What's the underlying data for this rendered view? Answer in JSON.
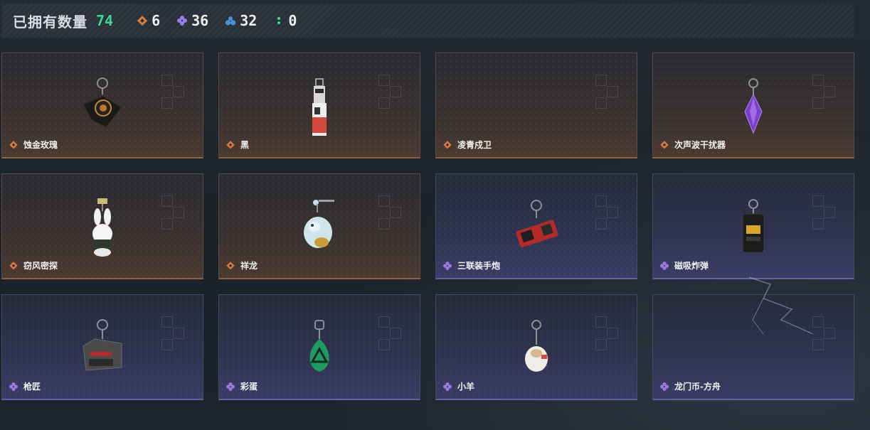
{
  "header": {
    "owned_label": "已拥有数量",
    "owned_count": "74",
    "stats": [
      {
        "icon": "orange-rarity-icon",
        "value": "6"
      },
      {
        "icon": "purple-rarity-icon",
        "value": "36"
      },
      {
        "icon": "blue-rarity-icon",
        "value": "32"
      },
      {
        "icon": "green-rarity-icon",
        "value": "0"
      }
    ]
  },
  "colors": {
    "orange": "#d97a3d",
    "purple": "#9a7ae0",
    "blue": "#4a90d9",
    "green": "#38d98a"
  },
  "items": [
    {
      "name": "蚀金玫瑰",
      "rarity": "orange",
      "icon": "gold-rose-charm-icon"
    },
    {
      "name": "黑",
      "rarity": "orange",
      "icon": "black-charm-icon"
    },
    {
      "name": "凌青戍卫",
      "rarity": "orange",
      "icon": ""
    },
    {
      "name": "次声波干扰器",
      "rarity": "orange",
      "icon": "purple-crystal-charm-icon"
    },
    {
      "name": "窃风密探",
      "rarity": "orange",
      "icon": "white-rabbit-charm-icon"
    },
    {
      "name": "祥龙",
      "rarity": "orange",
      "icon": "dragon-charm-icon"
    },
    {
      "name": "三联装手炮",
      "rarity": "purple",
      "icon": "hand-cannon-charm-icon"
    },
    {
      "name": "磁吸炸弹",
      "rarity": "purple",
      "icon": "magnetic-bomb-charm-icon"
    },
    {
      "name": "枪匠",
      "rarity": "purple",
      "icon": "gunsmith-case-charm-icon"
    },
    {
      "name": "彩蛋",
      "rarity": "purple",
      "icon": "green-egg-charm-icon"
    },
    {
      "name": "小羊",
      "rarity": "purple",
      "icon": "lamb-charm-icon"
    },
    {
      "name": "龙门币-方舟",
      "rarity": "purple",
      "icon": ""
    }
  ]
}
